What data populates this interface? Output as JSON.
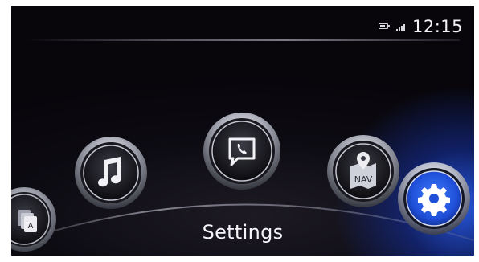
{
  "status": {
    "time": "12:15",
    "icons": [
      "battery-icon",
      "signal-icon"
    ]
  },
  "menu": {
    "items": [
      {
        "id": "applications",
        "icon": "applications-icon",
        "badge": "A"
      },
      {
        "id": "entertainment",
        "icon": "music-note-icon"
      },
      {
        "id": "communication",
        "icon": "phone-message-icon"
      },
      {
        "id": "navigation",
        "icon": "nav-map-icon",
        "badge": "NAV"
      },
      {
        "id": "settings",
        "icon": "gear-icon",
        "selected": true
      }
    ],
    "selected_label": "Settings"
  },
  "colors": {
    "accent_blue": "#2a62e8",
    "background": "#07050a",
    "chrome": "#c9ccd6"
  }
}
